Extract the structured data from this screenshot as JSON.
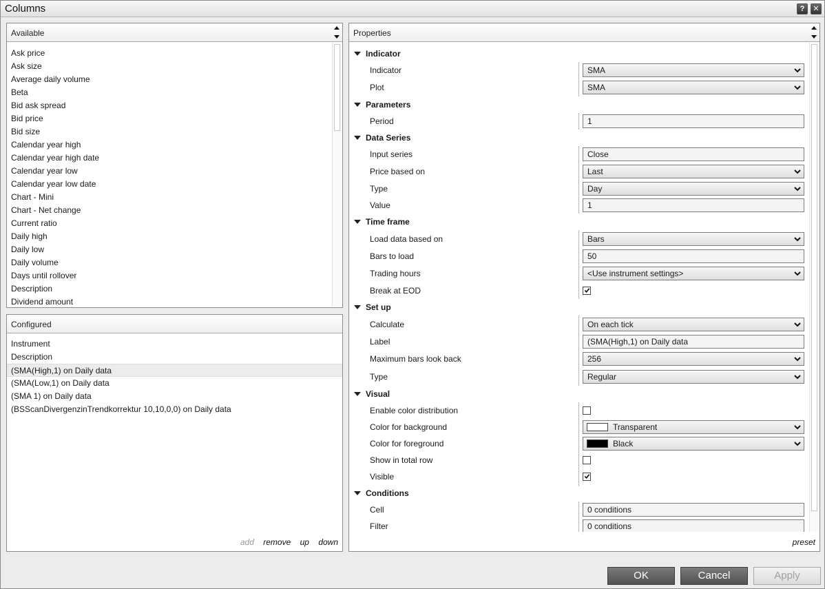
{
  "window": {
    "title": "Columns",
    "help_glyph": "?",
    "close_glyph": "✕"
  },
  "available": {
    "title": "Available",
    "items": [
      "Ask price",
      "Ask size",
      "Average daily volume",
      "Beta",
      "Bid ask spread",
      "Bid price",
      "Bid size",
      "Calendar year high",
      "Calendar year high date",
      "Calendar year low",
      "Calendar year low date",
      "Chart - Mini",
      "Chart - Net change",
      "Current ratio",
      "Daily high",
      "Daily low",
      "Daily volume",
      "Days until rollover",
      "Description",
      "Dividend amount"
    ]
  },
  "configured": {
    "title": "Configured",
    "items": [
      "Instrument",
      "Description",
      "(SMA(High,1) on Daily data",
      "(SMA(Low,1) on Daily data",
      "(SMA 1) on Daily data",
      "(BSScanDivergenzinTrendkorrektur 10,10,0,0) on Daily data"
    ],
    "selected_index": 2,
    "actions": {
      "add": "add",
      "remove": "remove",
      "up": "up",
      "down": "down"
    }
  },
  "properties": {
    "title": "Properties",
    "preset_label": "preset",
    "categories": {
      "indicator": "Indicator",
      "parameters": "Parameters",
      "data_series": "Data Series",
      "time_frame": "Time frame",
      "set_up": "Set up",
      "visual": "Visual",
      "conditions": "Conditions"
    },
    "rows": {
      "indicator": {
        "label": "Indicator",
        "value": "SMA"
      },
      "plot": {
        "label": "Plot",
        "value": "SMA"
      },
      "period": {
        "label": "Period",
        "value": "1"
      },
      "input_series": {
        "label": "Input series",
        "value": "Close"
      },
      "price_based_on": {
        "label": "Price based on",
        "value": "Last"
      },
      "type_ds": {
        "label": "Type",
        "value": "Day"
      },
      "value": {
        "label": "Value",
        "value": "1"
      },
      "load_data_based_on": {
        "label": "Load data based on",
        "value": "Bars"
      },
      "bars_to_load": {
        "label": "Bars to load",
        "value": "50"
      },
      "trading_hours": {
        "label": "Trading hours",
        "value": "<Use instrument settings>"
      },
      "break_at_eod": {
        "label": "Break at EOD",
        "checked": true
      },
      "calculate": {
        "label": "Calculate",
        "value": "On each tick"
      },
      "label": {
        "label": "Label",
        "value": "(SMA(High,1) on Daily data"
      },
      "max_bars_look_back": {
        "label": "Maximum bars look back",
        "value": "256"
      },
      "type_setup": {
        "label": "Type",
        "value": "Regular"
      },
      "enable_color_distribution": {
        "label": "Enable color distribution",
        "checked": false
      },
      "color_background": {
        "label": "Color for background",
        "value": "Transparent",
        "swatch": "#ffffff"
      },
      "color_foreground": {
        "label": "Color for foreground",
        "value": "Black",
        "swatch": "#000000"
      },
      "show_in_total_row": {
        "label": "Show in total row",
        "checked": false
      },
      "visible": {
        "label": "Visible",
        "checked": true
      },
      "cell": {
        "label": "Cell",
        "value": "0 conditions"
      },
      "filter": {
        "label": "Filter",
        "value": "0 conditions"
      }
    }
  },
  "buttons": {
    "ok": "OK",
    "cancel": "Cancel",
    "apply": "Apply"
  }
}
